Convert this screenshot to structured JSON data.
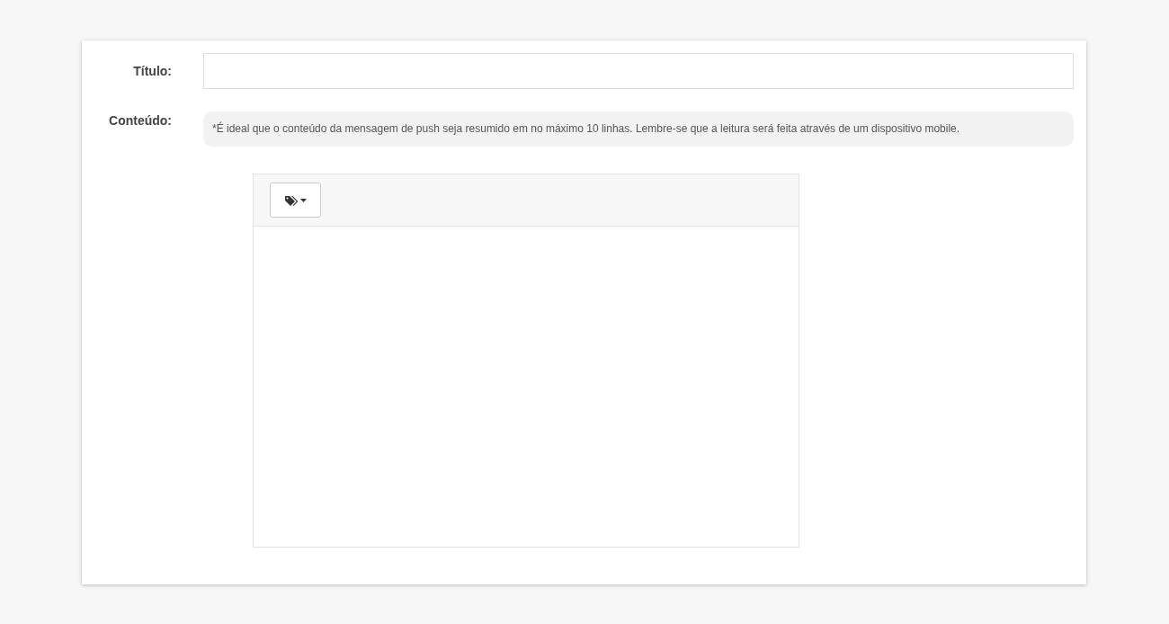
{
  "fields": [
    {
      "kind": "text",
      "label": "Título:"
    },
    {
      "kind": "editor",
      "label": "Conteúdo:",
      "note": "*É ideal que o conteúdo da mensagem de push seja resumido em no máximo 10 linhas. Lembre-se que a leitura será feita através de um dispositivo mobile."
    }
  ]
}
